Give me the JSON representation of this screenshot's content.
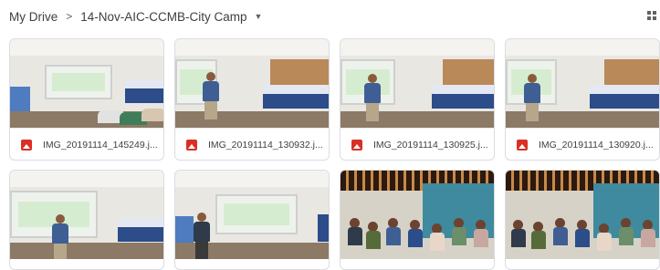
{
  "breadcrumb": {
    "root": "My Drive",
    "separator": ">",
    "folder": "14-Nov-AIC-CCMB-City Camp"
  },
  "files": [
    {
      "name": "IMG_20191114_145249.j..."
    },
    {
      "name": "IMG_20191114_130932.j..."
    },
    {
      "name": "IMG_20191114_130925.j..."
    },
    {
      "name": "IMG_20191114_130920.j..."
    }
  ],
  "colors": {
    "image_icon": "#d93025",
    "text": "#3c4043",
    "border": "#dadce0"
  }
}
